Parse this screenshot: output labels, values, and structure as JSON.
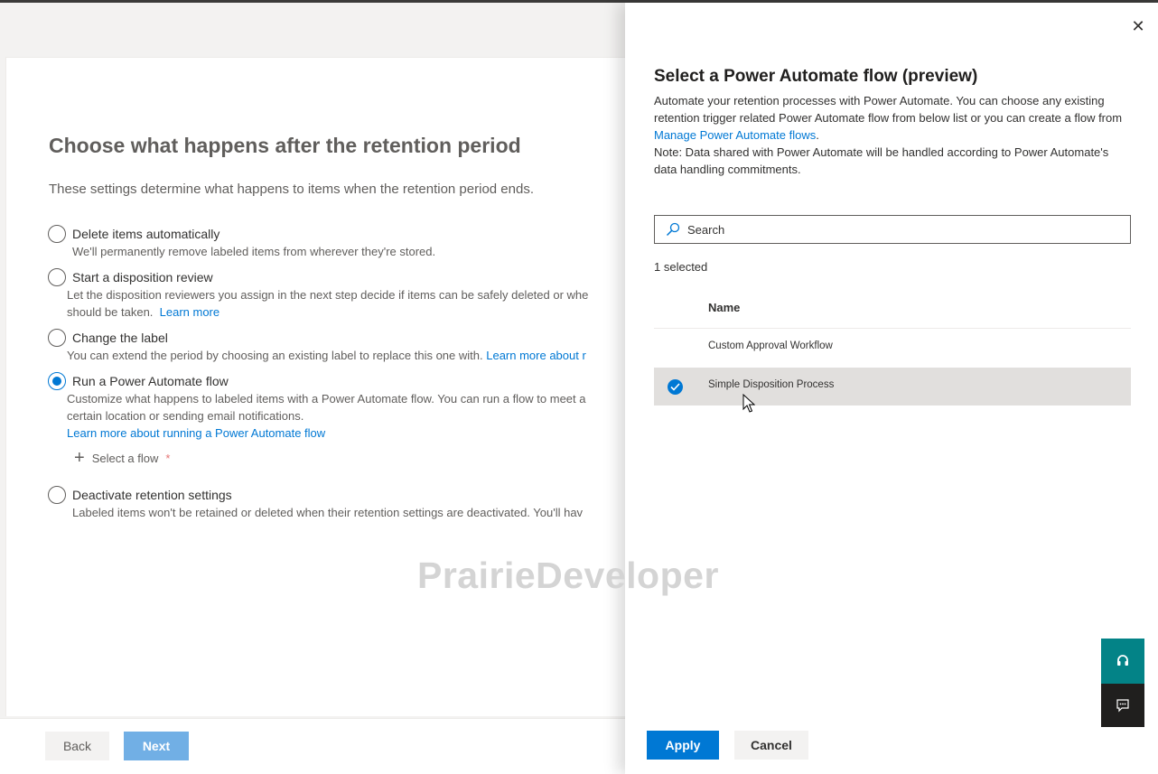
{
  "page": {
    "title": "Choose what happens after the retention period",
    "description": "These settings determine what happens to items when the retention period ends.",
    "options": [
      {
        "label": "Delete items automatically",
        "desc": "We'll permanently remove labeled items from wherever they're stored.",
        "checked": false
      },
      {
        "label": "Start a disposition review",
        "desc_line1": "Let the disposition reviewers you assign in the next step decide if items can be safely deleted or whe",
        "desc_line2": "should be taken.",
        "link": "Learn more",
        "checked": false
      },
      {
        "label": "Change the label",
        "desc": "You can extend the period by choosing an existing label to replace this one with.",
        "link": "Learn more about r",
        "checked": false
      },
      {
        "label": "Run a Power Automate flow",
        "desc_line1": "Customize what happens to labeled items with a Power Automate flow. You can run a flow to meet a",
        "desc_line2": "certain location or sending email notifications.",
        "link": "Learn more about running a Power Automate flow",
        "checked": true
      },
      {
        "label": "Deactivate retention settings",
        "desc": "Labeled items won't be retained or deleted when their retention settings are deactivated. You'll hav",
        "checked": false
      }
    ],
    "select_flow_label": "Select a flow",
    "required_mark": "*",
    "back_label": "Back",
    "next_label": "Next"
  },
  "watermark": "PrairieDeveloper",
  "panel": {
    "title": "Select a Power Automate flow (preview)",
    "desc_part1": "Automate your retention processes with Power Automate. You can choose any existing retention trigger related Power Automate flow from below list or you can create a flow from ",
    "desc_link": "Manage Power Automate flows",
    "desc_part2": ".",
    "note": "Note: Data shared with Power Automate will be handled according to Power Automate's data handling commitments.",
    "search_placeholder": "Search",
    "selected_count": "1 selected",
    "column_name": "Name",
    "rows": [
      {
        "name": "Custom Approval Workflow",
        "selected": false
      },
      {
        "name": "Simple Disposition Process",
        "selected": true
      }
    ],
    "apply_label": "Apply",
    "cancel_label": "Cancel",
    "close_glyph": "✕"
  },
  "colors": {
    "accent": "#0078d4",
    "help_teal": "#038387",
    "feedback_dark": "#201f1e"
  }
}
